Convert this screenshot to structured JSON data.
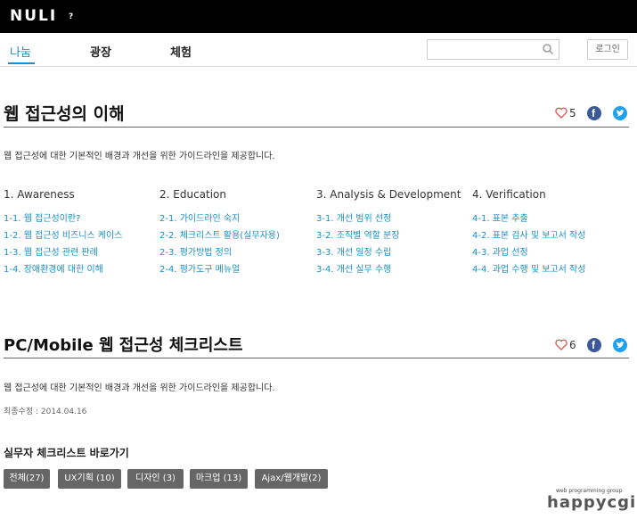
{
  "header": {
    "logo": "NULI",
    "logo_mark": "?"
  },
  "nav": {
    "items": [
      {
        "label": "나눔",
        "active": true
      },
      {
        "label": "광장",
        "active": false
      },
      {
        "label": "체험",
        "active": false
      }
    ],
    "search_placeholder": "",
    "login_label": "로그인"
  },
  "section1": {
    "title": "웹 접근성의 이해",
    "likes": "5",
    "description": "웹 접근성에 대한 기본적인 배경과 개선을 위한 가이드라인을 제공합니다.",
    "columns": [
      {
        "heading": "1. Awareness",
        "links": [
          "1-1. 웹 접근성이란?",
          "1-2. 웹 접근성 비즈니스 케이스",
          "1-3. 웹 접근성 관련 판례",
          "1-4. 장애환경에 대한 이해"
        ]
      },
      {
        "heading": "2. Education",
        "links": [
          "2-1. 가이드라인 숙지",
          "2-2. 체크리스트 활용(실무자용)",
          "2-3. 평가방법 정의",
          "2-4. 평가도구 메뉴얼"
        ]
      },
      {
        "heading": "3. Analysis & Development",
        "links": [
          "3-1. 개선 범위 선정",
          "3-2. 조직별 역할 분장",
          "3-3. 개선 일정 수립",
          "3-4. 개선 실무 수행"
        ]
      },
      {
        "heading": "4. Verification",
        "links": [
          "4-1. 표본 추출",
          "4-2. 표본 검사 및 보고서 작성",
          "4-3. 과업 선정",
          "4-4. 과업 수행 및 보고서 작성"
        ]
      }
    ]
  },
  "section2": {
    "title": "PC/Mobile 웹 접근성 체크리스트",
    "likes": "6",
    "description": "웹 접근성에 대한 기본적인 배경과 개선을 위한 가이드라인을 제공합니다.",
    "updated": "최종수정 : 2014.04.16",
    "shortcut_title": "실무자 체크리스트 바로가기",
    "tags": [
      "전체(27)",
      "UX기획 (10)",
      "디자인 (3)",
      "마크업 (13)",
      "Ajax/웹개발(2)"
    ]
  },
  "watermark": {
    "small": "web programming group",
    "main": "happycgi"
  },
  "colors": {
    "accent": "#1a8fc9",
    "facebook": "#3b5998",
    "twitter": "#1da1f2",
    "tag_bg": "#666666",
    "heart": "#d9534f"
  }
}
